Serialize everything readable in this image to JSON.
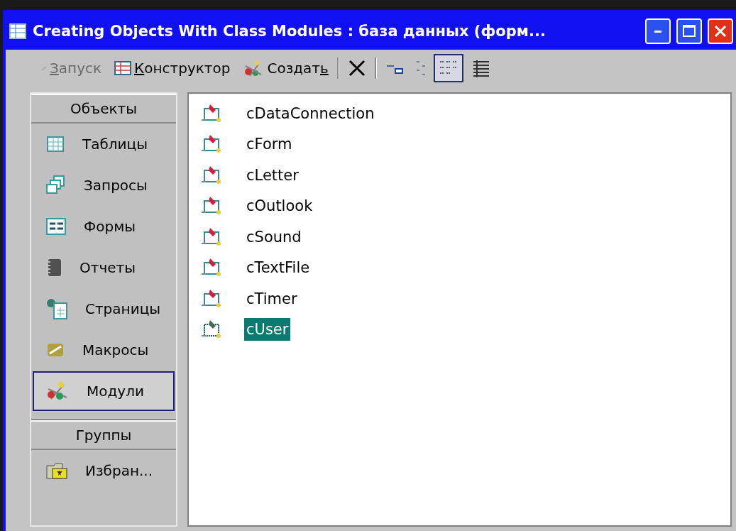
{
  "window": {
    "title": "Creating Objects With Class Modules : база данных (форм..."
  },
  "toolbar": [
    {
      "kind": "run",
      "mnemonic": "З",
      "after": "апуск",
      "disabled": true,
      "selected": false
    },
    {
      "kind": "design",
      "mnemonic": "К",
      "after": "онструктор",
      "disabled": false,
      "selected": false
    },
    {
      "kind": "new",
      "before": "Создат",
      "mnemonic": "ь",
      "disabled": false,
      "selected": false
    },
    {
      "kind": "delete",
      "disabled": false,
      "selected": false
    },
    {
      "kind": "large-icons",
      "disabled": false,
      "selected": false
    },
    {
      "kind": "small-icons",
      "disabled": false,
      "selected": false
    },
    {
      "kind": "list",
      "disabled": false,
      "selected": true
    },
    {
      "kind": "details",
      "disabled": false,
      "selected": false
    }
  ],
  "sidebar": {
    "sections": [
      {
        "header": "Объекты",
        "items": [
          {
            "kind": "tables",
            "label": "Таблицы",
            "selected": false
          },
          {
            "kind": "queries",
            "label": "Запросы",
            "selected": false
          },
          {
            "kind": "forms",
            "label": "Формы",
            "selected": false
          },
          {
            "kind": "reports",
            "label": "Отчеты",
            "selected": false
          },
          {
            "kind": "pages",
            "label": "Страницы",
            "selected": false
          },
          {
            "kind": "macros",
            "label": "Макросы",
            "selected": false
          },
          {
            "kind": "modules",
            "label": "Модули",
            "selected": true
          }
        ]
      },
      {
        "header": "Группы",
        "items": [
          {
            "kind": "favorites",
            "label": "Избран...",
            "selected": false
          }
        ]
      }
    ]
  },
  "list": {
    "items": [
      {
        "name": "cDataConnection",
        "selected": false
      },
      {
        "name": "cForm",
        "selected": false
      },
      {
        "name": "cLetter",
        "selected": false
      },
      {
        "name": "cOutlook",
        "selected": false
      },
      {
        "name": "cSound",
        "selected": false
      },
      {
        "name": "cTextFile",
        "selected": false
      },
      {
        "name": "cTimer",
        "selected": false
      },
      {
        "name": "cUser",
        "selected": true
      }
    ]
  }
}
